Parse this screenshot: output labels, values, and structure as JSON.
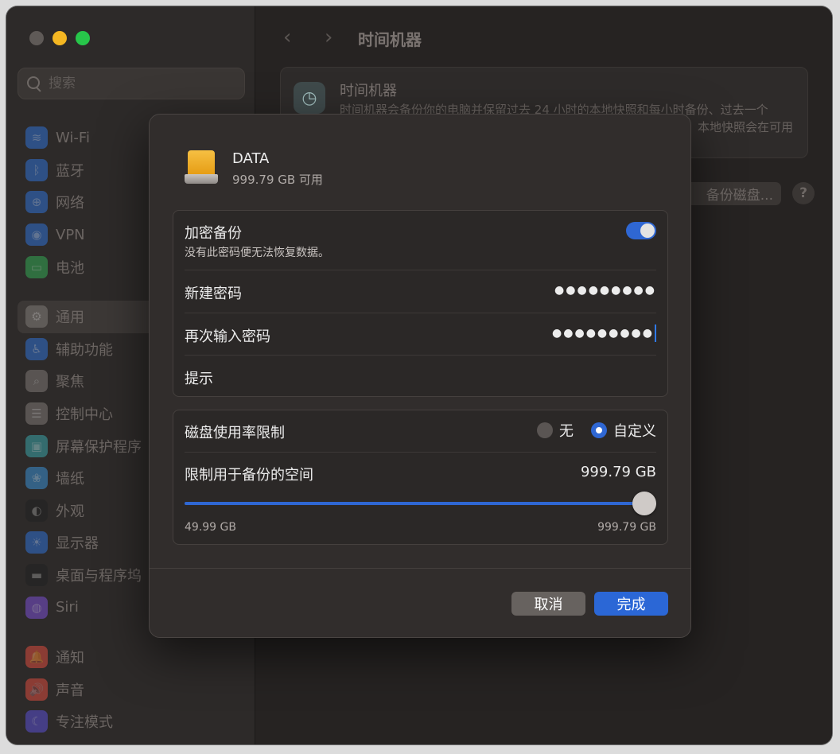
{
  "sidebar": {
    "search_placeholder": "搜索",
    "items": [
      {
        "label": "Wi-Fi",
        "icon": "wifi-icon",
        "color": "#2f6fd1",
        "glyph": "≋"
      },
      {
        "label": "蓝牙",
        "icon": "bluetooth-icon",
        "color": "#2f6fd1",
        "glyph": "ᛒ"
      },
      {
        "label": "网络",
        "icon": "network-icon",
        "color": "#2f6fd1",
        "glyph": "⊕"
      },
      {
        "label": "VPN",
        "icon": "vpn-icon",
        "color": "#2f6fd1",
        "glyph": "◉"
      },
      {
        "label": "电池",
        "icon": "battery-icon",
        "color": "#34a853",
        "glyph": "▭"
      },
      {
        "label": "通用",
        "icon": "general-icon",
        "color": "#7d7875",
        "glyph": "⚙",
        "active": true
      },
      {
        "label": "辅助功能",
        "icon": "accessibility-icon",
        "color": "#2f6fd1",
        "glyph": "♿"
      },
      {
        "label": "聚焦",
        "icon": "spotlight-icon",
        "color": "#7d7875",
        "glyph": "⌕"
      },
      {
        "label": "控制中心",
        "icon": "control-center-icon",
        "color": "#7d7875",
        "glyph": "☰"
      },
      {
        "label": "屏幕保护程序",
        "icon": "screensaver-icon",
        "color": "#3aa3a8",
        "glyph": "▣"
      },
      {
        "label": "墙纸",
        "icon": "wallpaper-icon",
        "color": "#3a8fd1",
        "glyph": "❀"
      },
      {
        "label": "外观",
        "icon": "appearance-icon",
        "color": "#222222",
        "glyph": "◐"
      },
      {
        "label": "显示器",
        "icon": "displays-icon",
        "color": "#2f6fd1",
        "glyph": "☀"
      },
      {
        "label": "桌面与程序坞",
        "icon": "desktop-dock-icon",
        "color": "#222222",
        "glyph": "▬"
      },
      {
        "label": "Siri",
        "icon": "siri-icon",
        "color": "#7a4fd1",
        "glyph": "◍"
      },
      {
        "label": "通知",
        "icon": "notifications-icon",
        "color": "#d94b3d",
        "glyph": "🔔"
      },
      {
        "label": "声音",
        "icon": "sound-icon",
        "color": "#d94b3d",
        "glyph": "🔊"
      },
      {
        "label": "专注模式",
        "icon": "focus-icon",
        "color": "#5a4fd1",
        "glyph": "☾"
      }
    ]
  },
  "main": {
    "title": "时间机器",
    "card": {
      "title": "时间机器",
      "description": "时间机器会备份你的电脑并保留过去 24 小时的本地快照和每小时备份、过去一个",
      "description_tail": "本地快照会在可用"
    },
    "backup_disk_button": "备份磁盘...",
    "help_button": "?"
  },
  "dialog": {
    "disk_name": "DATA",
    "disk_free": "999.79 GB 可用",
    "encrypt": {
      "label": "加密备份",
      "sublabel": "没有此密码便无法恢复数据。",
      "enabled": true
    },
    "new_password": {
      "label": "新建密码",
      "value": "●●●●●●●●●"
    },
    "confirm_password": {
      "label": "再次输入密码",
      "value": "●●●●●●●●●"
    },
    "hint": {
      "label": "提示"
    },
    "disk_limit": {
      "label": "磁盘使用率限制",
      "options": [
        "无",
        "自定义"
      ],
      "selected": "自定义"
    },
    "space": {
      "label": "限制用于备份的空间",
      "value": "999.79 GB",
      "min_label": "49.99 GB",
      "max_label": "999.79 GB",
      "slider_fraction": 1.0
    },
    "cancel_label": "取消",
    "done_label": "完成"
  }
}
